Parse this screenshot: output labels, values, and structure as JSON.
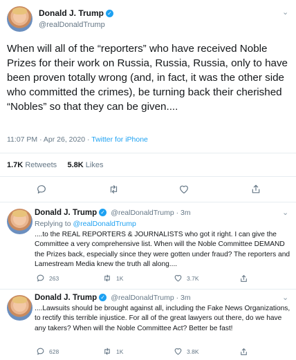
{
  "main_tweet": {
    "author_name": "Donald J. Trump",
    "handle": "@realDonaldTrump",
    "text": "When will all of the “reporters” who have received Noble Prizes for their work on Russia, Russia, Russia, only to have been proven totally wrong (and, in fact, it was the other side who committed the crimes), be turning back their cherished “Nobles” so that they can be given....",
    "timestamp": "11:07 PM · Apr 26, 2020 · ",
    "source": "Twitter for iPhone",
    "retweets_count": "1.7K",
    "retweets_label": "Retweets",
    "likes_count": "5.8K",
    "likes_label": "Likes"
  },
  "replies": [
    {
      "author_name": "Donald J. Trump",
      "handle_time": "@realDonaldTrump · 3m",
      "replying_label": "Replying to ",
      "replying_handle": "@realDonaldTrump",
      "text": "....to the REAL REPORTERS & JOURNALISTS who got it right. I can give the Committee a very comprehensive list. When will the Noble Committee DEMAND the Prizes back, especially since they were gotten under fraud? The reporters and Lamestream Media knew the truth all along....",
      "reply_count": "263",
      "retweet_count": "1K",
      "like_count": "3.7K"
    },
    {
      "author_name": "Donald J. Trump",
      "handle_time": "@realDonaldTrump · 3m",
      "text": "....Lawsuits should be brought against all, including the Fake News Organizations, to rectify this terrible injustice. For all of the great lawyers out there, do we have any takers? When will the Noble Committee Act? Better be fast!",
      "reply_count": "628",
      "retweet_count": "1K",
      "like_count": "3.8K"
    }
  ],
  "icons": {
    "verified": "verified-badge-icon",
    "chevron": "chevron-down-icon",
    "reply": "reply-icon",
    "retweet": "retweet-icon",
    "like": "heart-icon",
    "share": "share-icon"
  },
  "colors": {
    "accent": "#1da1f2",
    "text": "#14171a",
    "muted": "#657786",
    "divider": "#e6ecf0"
  }
}
